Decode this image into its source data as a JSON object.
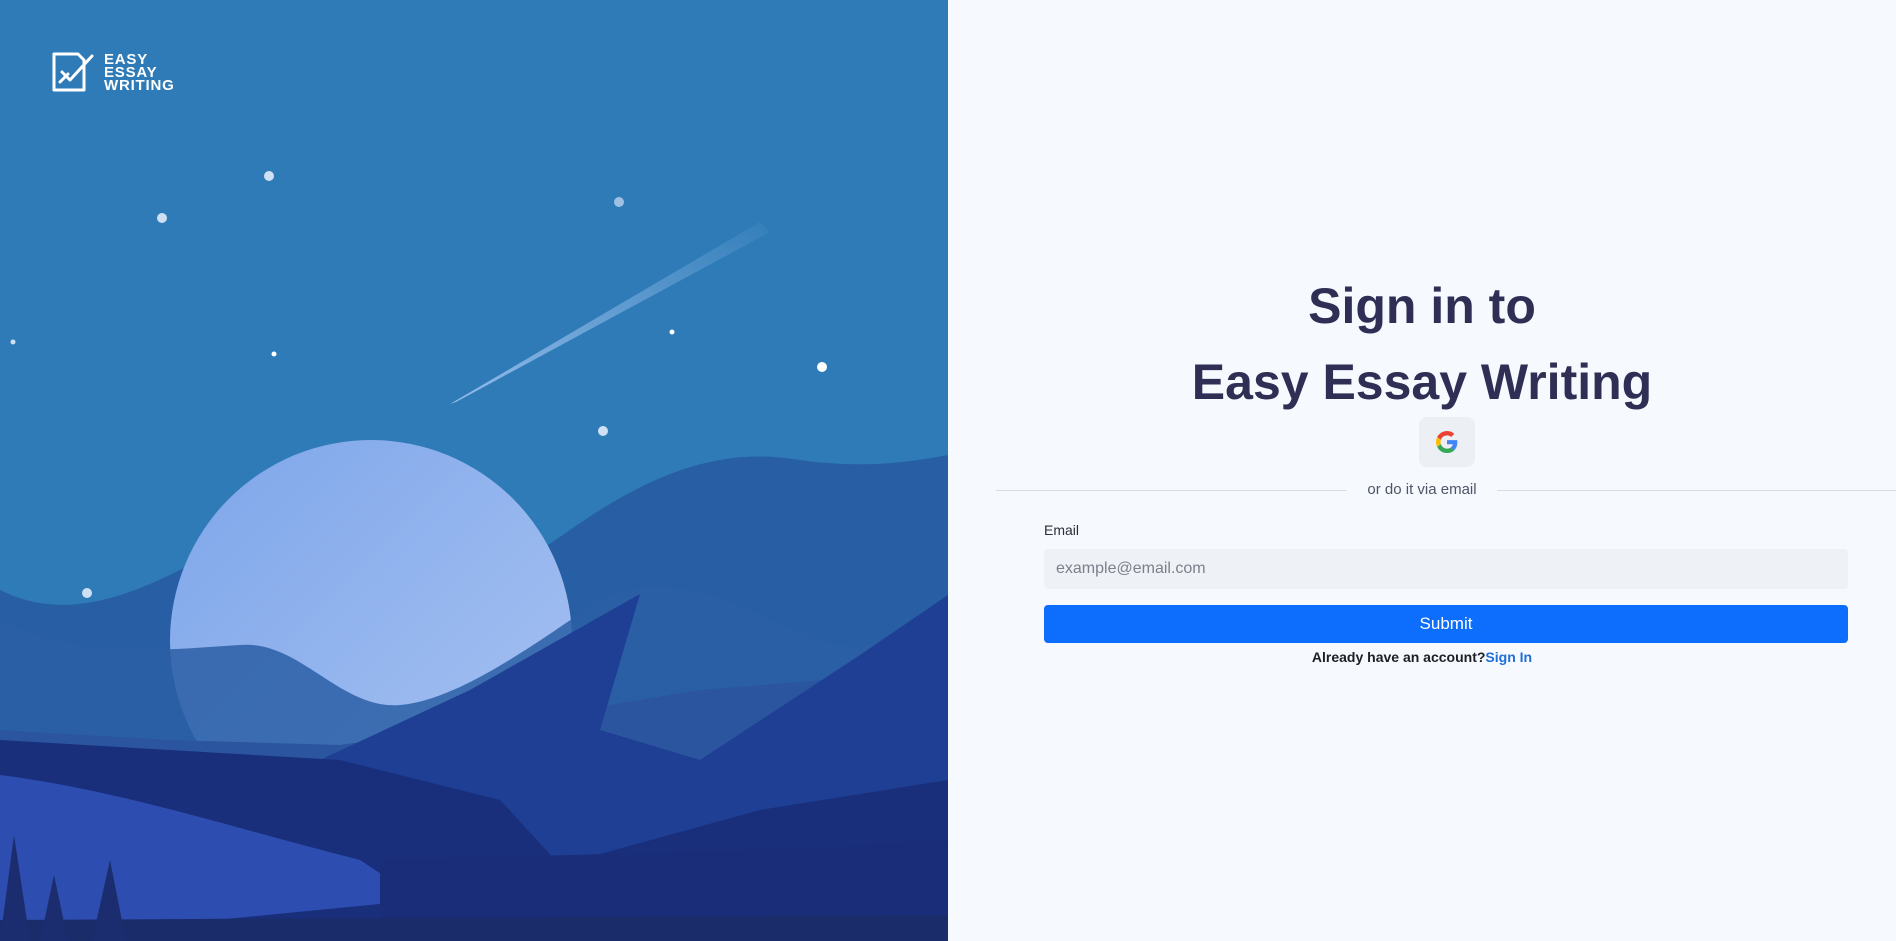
{
  "brand": {
    "logo_lines": [
      "EASY",
      "ESSAY",
      "WRITING"
    ],
    "logo_icon": "pen-document-icon"
  },
  "signin": {
    "title_line1": "Sign in to",
    "title_line2": "Easy Essay Writing",
    "google_icon": "google-icon",
    "divider_text": "or do it via email",
    "email_label": "Email",
    "email_placeholder": "example@email.com",
    "email_value": "",
    "submit_label": "Submit",
    "account_question": "Already have an account?",
    "signin_link": "Sign In"
  },
  "colors": {
    "left_background": "#2e7bb7",
    "right_background": "#f6f9fd",
    "title": "#2f2f55",
    "primary_button": "#0d6efd",
    "link": "#1f6fd8"
  }
}
